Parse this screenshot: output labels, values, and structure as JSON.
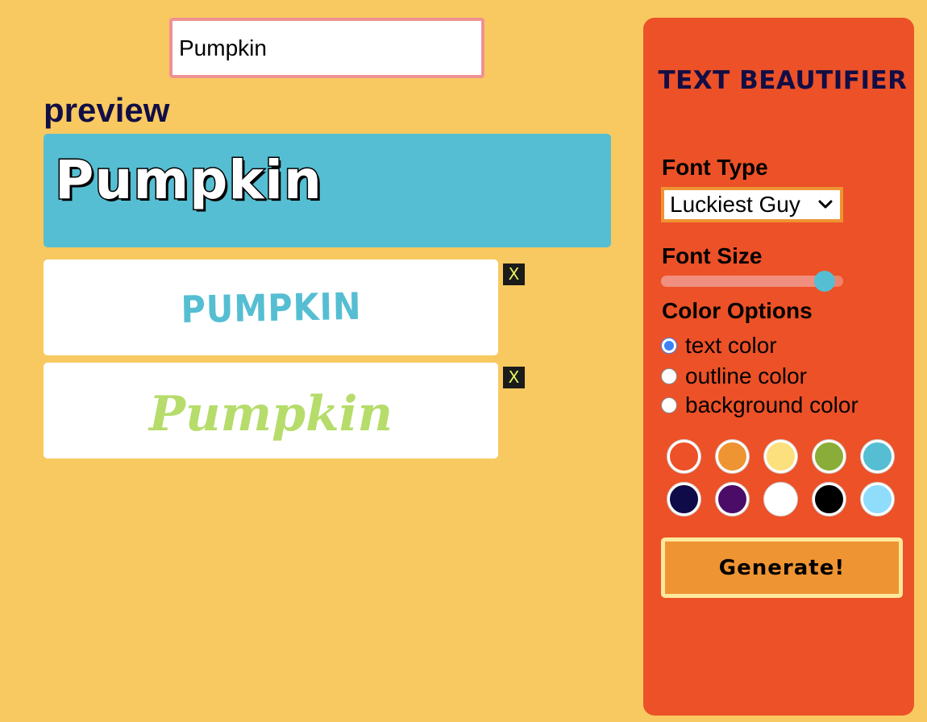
{
  "input": {
    "value": "Pumpkin"
  },
  "preview": {
    "heading": "preview",
    "text": "Pumpkin",
    "background_color": "#56bed2",
    "text_color": "#ffffff",
    "outline_color": "#000000"
  },
  "results": [
    {
      "text": "PUMPKIN",
      "color": "#56bed2",
      "delete_label": "X"
    },
    {
      "text": "Pumpkin",
      "color": "#b6dc6b",
      "delete_label": "X"
    }
  ],
  "panel": {
    "title": "TEXT BEAUTIFIER",
    "font_type_label": "Font Type",
    "font_type_value": "Luckiest Guy",
    "font_size_label": "Font Size",
    "font_size_fraction": 0.9,
    "color_options_label": "Color Options",
    "color_options": [
      {
        "label": "text color",
        "checked": true
      },
      {
        "label": "outline color",
        "checked": false
      },
      {
        "label": "background color",
        "checked": false
      }
    ],
    "swatch_colors": [
      "#ed5127",
      "#ee9433",
      "#fbe07d",
      "#89ad38",
      "#56bed2",
      "#0f0a48",
      "#4b0c68",
      "#ffffff",
      "#000000",
      "#8fdcfb"
    ],
    "generate_label": "Generate!"
  },
  "colors": {
    "page_background": "#f8c960",
    "panel_background": "#ed5127",
    "accent_orange": "#ee9433",
    "input_border": "#ee9294"
  }
}
